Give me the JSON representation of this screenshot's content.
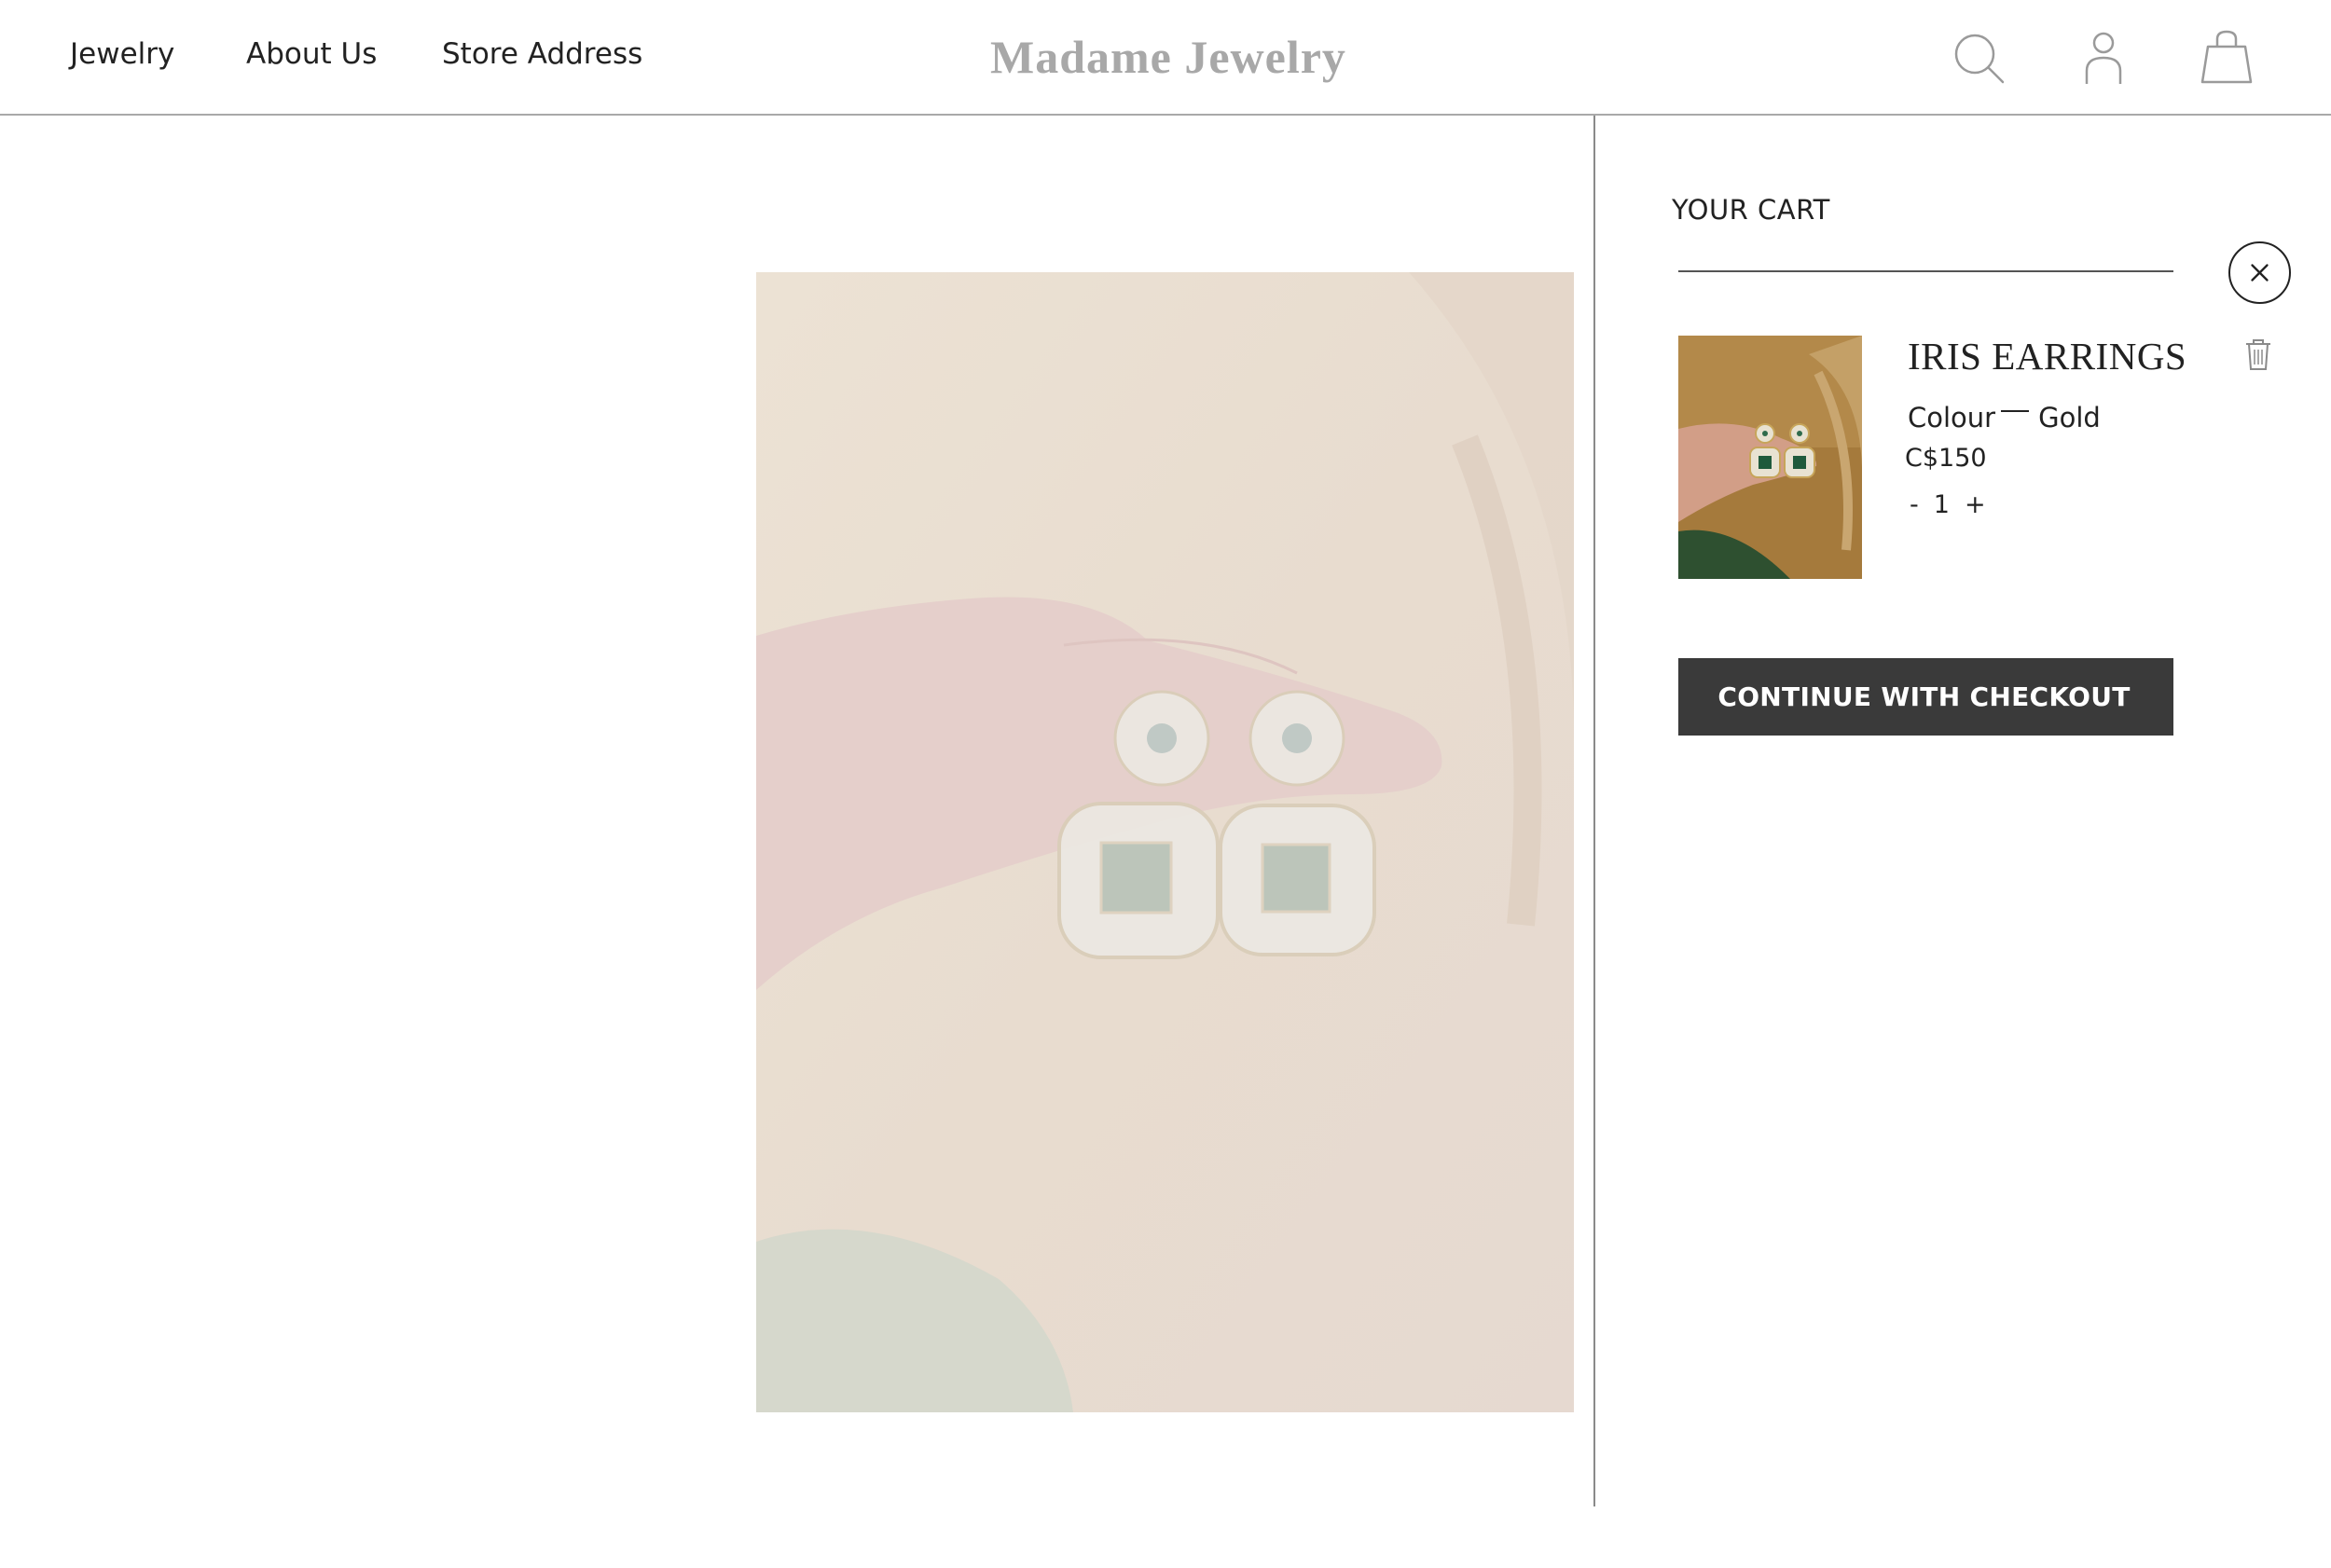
{
  "header": {
    "nav": [
      {
        "label": "Jewelry"
      },
      {
        "label": "About Us"
      },
      {
        "label": "Store Address"
      }
    ],
    "brand": "Madame Jewelry",
    "icons": [
      "search-icon",
      "account-icon",
      "shopping-bag-icon"
    ]
  },
  "cart": {
    "title": "YOUR CART",
    "items": [
      {
        "name": "IRIS EARRINGS",
        "variant_label": "Colour",
        "variant_value": "Gold",
        "price": "C$150",
        "qty_minus": "-",
        "quantity": "1",
        "qty_plus": "+"
      }
    ],
    "checkout_label": "CONTINUE WITH CHECKOUT"
  },
  "colors": {
    "brand_text": "#a8a8a8",
    "checkout_bg": "#3a3a3a",
    "product_overlay": "#e9dfd6"
  }
}
